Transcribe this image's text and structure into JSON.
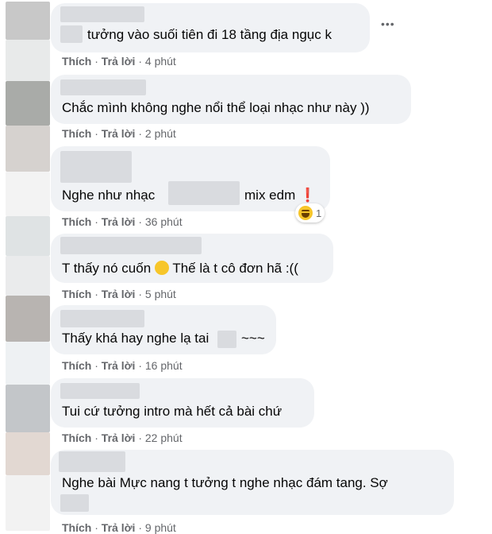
{
  "comments": [
    {
      "text_after": "tưởng vào suối tiên đi 18 tầng địa ngục k",
      "like": "Thích",
      "reply": "Trả lời",
      "time": "4 phút"
    },
    {
      "text": "Chắc mình không nghe nổi thể loại nhạc như này ))",
      "like": "Thích",
      "reply": "Trả lời",
      "time": "2 phút"
    },
    {
      "text_before": "Nghe như nhạc",
      "text_after": "mix edm",
      "emoji": "❗",
      "reaction_icon": "haha-icon",
      "reaction_count": "1",
      "like": "Thích",
      "reply": "Trả lời",
      "time": "36 phút"
    },
    {
      "text_before": "T thấy nó cuốn",
      "emoji": "smiling-face-icon",
      "text_after": "Thế là t cô đơn hã :((",
      "like": "Thích",
      "reply": "Trả lời",
      "time": "5 phút"
    },
    {
      "text_before": "Thấy khá hay nghe lạ tai",
      "text_after": "~~~",
      "like": "Thích",
      "reply": "Trả lời",
      "time": "16 phút"
    },
    {
      "text": "Tui cứ tưởng intro mà hết cả bài chứ",
      "like": "Thích",
      "reply": "Trả lời",
      "time": "22 phút"
    },
    {
      "text": "Nghe bài Mực nang t tưởng t nghe nhạc đám tang. Sợ",
      "like": "Thích",
      "reply": "Trả lời",
      "time": "9 phút"
    }
  ],
  "more_label": "•••",
  "dot": "·"
}
